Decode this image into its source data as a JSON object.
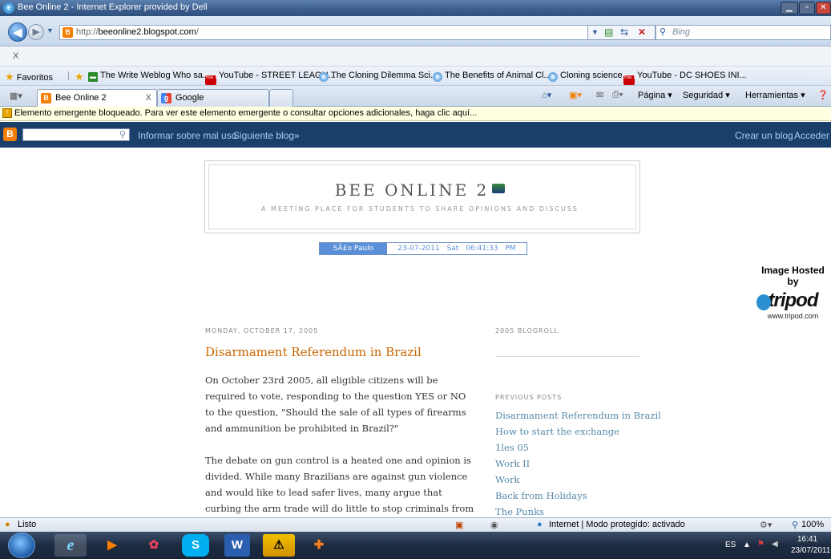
{
  "window": {
    "title": "Bee Online 2 - Internet Explorer provided by Dell"
  },
  "address_bar": {
    "url_prefix": "http://",
    "url_host": "beeonline2.blogspot.com",
    "url_suffix": "/",
    "search_placeholder": "Bing"
  },
  "close_strip": {
    "label": "X"
  },
  "favorites_bar": {
    "favorites_label": "Favoritos",
    "items": [
      "The Write Weblog Who sa...",
      "YouTube - STREET LEAGU...",
      "The Cloning Dilemma  Sci...",
      "The Benefits of Animal Cl...",
      "Cloning science",
      "YouTube - DC SHOES INI..."
    ]
  },
  "tabs": [
    {
      "label": "Bee Online 2",
      "close": "X"
    },
    {
      "label": "Google"
    }
  ],
  "command_bar": {
    "page": "Página ▾",
    "security": "Seguridad ▾",
    "tools": "Herramientas ▾"
  },
  "info_bar": {
    "text": "Elemento emergente bloqueado. Para ver este elemento emergente o consultar opciones adicionales, haga clic aquí..."
  },
  "blogger_nav": {
    "report": "Informar sobre mal uso",
    "next": "Siguiente blog»",
    "create": "Crear un blog",
    "login": "Acceder"
  },
  "blog": {
    "title": "BEE ONLINE 2",
    "description": "A MEETING PLACE FOR STUDENTS TO SHARE OPINIONS AND DISCUSS",
    "clock": {
      "city": "SÃ£o Paulo",
      "date": "23-07-2011",
      "day": "Sat",
      "time": "06:41:33 PM"
    },
    "tripod": {
      "heading": "Image Hosted by",
      "logo": "tripod",
      "url": "www.tripod.com"
    },
    "post": {
      "date": "MONDAY, OCTOBER 17, 2005",
      "title": "Disarmament Referendum in Brazil",
      "p1": "On October 23rd 2005, all eligible citizens will be required to vote, responding to the question YES or NO to the question, \"Should the sale of all types of firearms and ammunition be prohibited in Brazil?\"",
      "p2": "The debate on gun control is a heated one and opinion is divided. While many Brazilians are against gun violence and would like to lead safer lives, many argue that curbing the arm trade will do little to stop criminals from using them and will further encourage illegal gun trade."
    },
    "sidebar": {
      "blogroll": "2005 BLOGROLL",
      "previous_posts_title": "PREVIOUS POSTS",
      "previous_posts": [
        "Disarmament Referendum in Brazil",
        "How to start the exchange",
        "1les 05",
        "Work II",
        "Work",
        "Back from Holidays",
        "The Punks"
      ]
    }
  },
  "status_bar": {
    "left": "Listo",
    "zone": "Internet | Modo protegido: activado",
    "zoom": "100%"
  },
  "taskbar": {
    "lang": "ES",
    "time": "16:41",
    "date": "23/07/2011"
  }
}
